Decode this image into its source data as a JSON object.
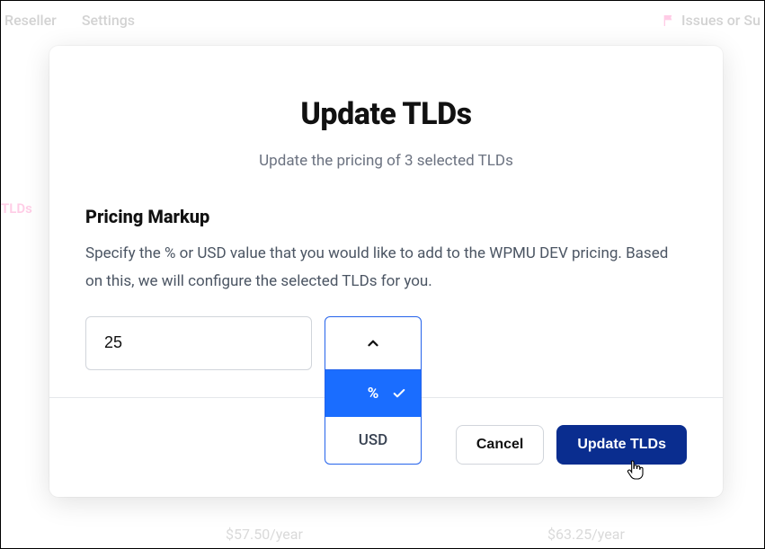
{
  "background": {
    "nav": [
      "Reseller",
      "Settings"
    ],
    "issues_label": "Issues or Su",
    "left_link": "TLDs",
    "price_left": "$57.50/year",
    "price_right": "$63.25/year"
  },
  "modal": {
    "title": "Update TLDs",
    "subtitle": "Update the pricing of 3 selected TLDs",
    "section_heading": "Pricing Markup",
    "section_desc": "Specify the % or USD value that you would like to add to the WPMU DEV pricing. Based on this, we will configure the selected TLDs for you.",
    "markup_value": "25",
    "dropdown": {
      "selected": "%",
      "options": [
        "%",
        "USD"
      ]
    },
    "buttons": {
      "cancel": "Cancel",
      "submit": "Update TLDs"
    }
  }
}
